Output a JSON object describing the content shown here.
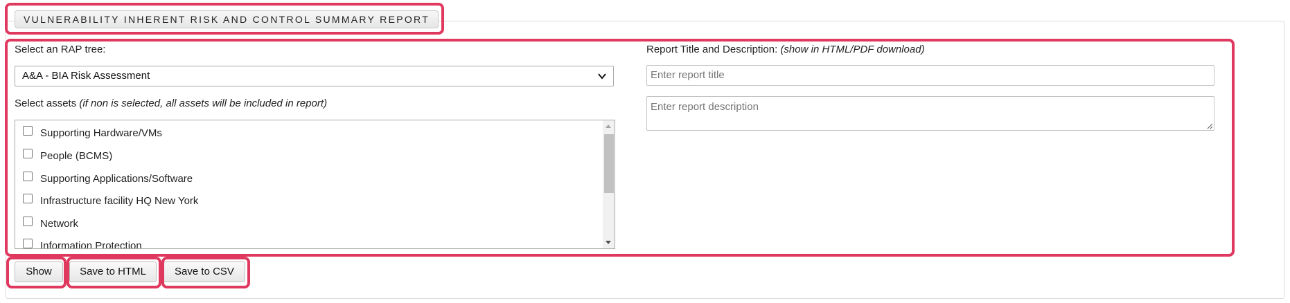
{
  "header": {
    "title": "VULNERABILITY INHERENT RISK AND CONTROL SUMMARY REPORT"
  },
  "rap_tree": {
    "label": "Select an RAP tree:",
    "selected": "A&A - BIA Risk Assessment"
  },
  "assets": {
    "label": "Select assets",
    "hint": "(if non is selected, all assets will be included in report)",
    "items": [
      {
        "label": "Supporting Hardware/VMs",
        "checked": false
      },
      {
        "label": "People (BCMS)",
        "checked": false
      },
      {
        "label": "Supporting Applications/Software",
        "checked": false
      },
      {
        "label": "Infrastructure facility HQ New York",
        "checked": false
      },
      {
        "label": "Network",
        "checked": false
      },
      {
        "label": "Information Protection",
        "checked": false
      }
    ]
  },
  "report": {
    "label": "Report Title and Description:",
    "hint": "(show in HTML/PDF download)",
    "title_placeholder": "Enter report title",
    "description_placeholder": "Enter report description"
  },
  "actions": {
    "show": "Show",
    "save_html": "Save to HTML",
    "save_csv": "Save to CSV"
  },
  "colors": {
    "highlight": "#e0395f",
    "panel_border": "#dcdcdc"
  }
}
